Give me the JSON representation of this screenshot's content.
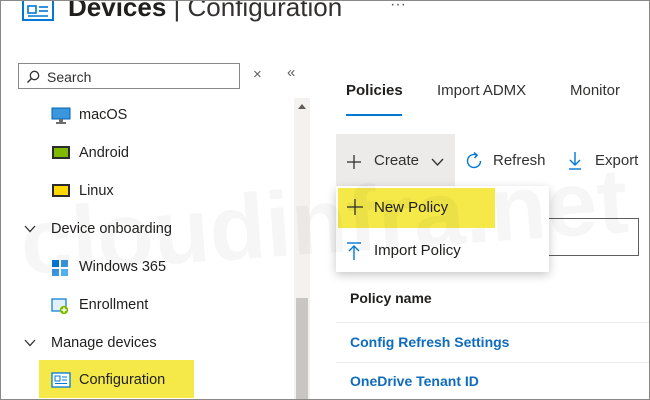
{
  "header": {
    "title_bold": "Devices",
    "title_sep": " | ",
    "title_light": "Configuration",
    "more": "···"
  },
  "sidebar": {
    "search_placeholder": "Search",
    "close_glyph": "×",
    "collapse_glyph": "«",
    "items": [
      {
        "label": "macOS",
        "icon": "monitor-icon"
      },
      {
        "label": "Android",
        "icon": "android-device-icon"
      },
      {
        "label": "Linux",
        "icon": "linux-device-icon"
      },
      {
        "label": "Device onboarding",
        "icon": "chevron-down-icon"
      },
      {
        "label": "Windows 365",
        "icon": "windows365-icon"
      },
      {
        "label": "Enrollment",
        "icon": "enrollment-icon"
      },
      {
        "label": "Manage devices",
        "icon": "chevron-down-icon"
      },
      {
        "label": "Configuration",
        "icon": "configuration-icon",
        "selected": true
      }
    ]
  },
  "main": {
    "tabs": [
      {
        "label": "Policies",
        "active": true
      },
      {
        "label": "Import ADMX"
      },
      {
        "label": "Monitor"
      }
    ],
    "commands": {
      "create": "Create",
      "refresh": "Refresh",
      "export": "Export"
    },
    "dropdown": [
      {
        "label": "New Policy",
        "icon": "plus-icon",
        "highlighted": true
      },
      {
        "label": "Import Policy",
        "icon": "import-icon"
      }
    ],
    "table": {
      "column": "Policy name",
      "rows": [
        "Config Refresh Settings",
        "OneDrive Tenant ID"
      ]
    }
  },
  "watermark": "cloudinfra.net",
  "colors": {
    "accent": "#0078d4",
    "highlight": "#f5e94a",
    "link": "#0f6cbd"
  }
}
